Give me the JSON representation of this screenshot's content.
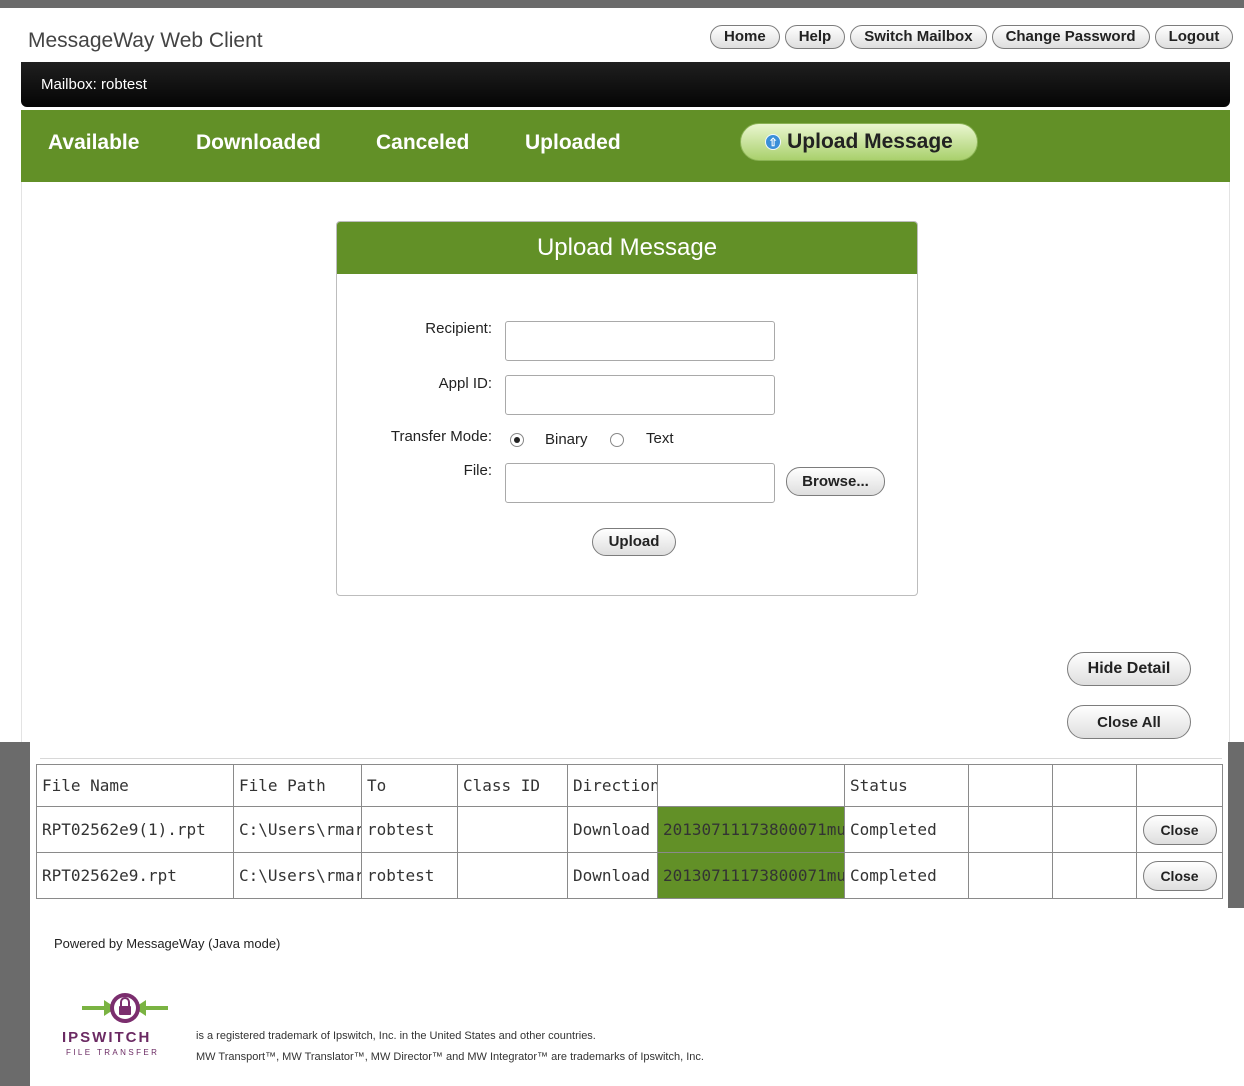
{
  "app": {
    "title": "MessageWay Web Client"
  },
  "topnav": {
    "home": "Home",
    "help": "Help",
    "switch_mailbox": "Switch Mailbox",
    "change_password": "Change Password",
    "logout": "Logout"
  },
  "mailbox": {
    "label": "Mailbox: robtest"
  },
  "tabs": {
    "available": "Available",
    "downloaded": "Downloaded",
    "canceled": "Canceled",
    "uploaded": "Uploaded",
    "upload_message": "Upload Message"
  },
  "upload_form": {
    "title": "Upload Message",
    "recipient_label": "Recipient:",
    "recipient_value": "",
    "appl_id_label": "Appl ID:",
    "appl_id_value": "",
    "transfer_mode_label": "Transfer Mode:",
    "mode_binary": "Binary",
    "mode_text": "Text",
    "selected_mode": "Binary",
    "file_label": "File:",
    "file_value": "",
    "browse_label": "Browse...",
    "upload_label": "Upload"
  },
  "detail": {
    "hide_detail": "Hide Detail",
    "close_all": "Close All"
  },
  "transfers": {
    "headers": [
      "File Name",
      "File Path",
      "To",
      "Class ID",
      "Direction",
      "",
      "Status",
      "",
      "",
      ""
    ],
    "rows": [
      {
        "file_name": "RPT02562e9(1).rpt",
        "file_path": "C:\\Users\\rmar",
        "to": "robtest",
        "class_id": "",
        "direction": "Download",
        "reference": "20130711173800071mu",
        "status": "Completed",
        "close_label": "Close"
      },
      {
        "file_name": "RPT02562e9.rpt",
        "file_path": "C:\\Users\\rmar",
        "to": "robtest",
        "class_id": "",
        "direction": "Download",
        "reference": "20130711173800071mu",
        "status": "Completed",
        "close_label": "Close"
      }
    ]
  },
  "footer": {
    "powered_by": "Powered by MessageWay (Java mode)",
    "logo_word": "IPSWITCH",
    "logo_sub": "FILE TRANSFER",
    "trademark_1": "is a registered trademark of Ipswitch, Inc. in the United States and other countries.",
    "trademark_2": "MW Transport™, MW Translator™, MW Director™ and MW Integrator™ are trademarks of Ipswitch, Inc."
  },
  "colors": {
    "brand_green": "#629027",
    "light_green": "#a9d06c",
    "mailbox_bar": "#0a0a0a"
  },
  "icons": {
    "upload_tab": "up-arrow-icon",
    "logo": "lock-arrows-icon"
  }
}
